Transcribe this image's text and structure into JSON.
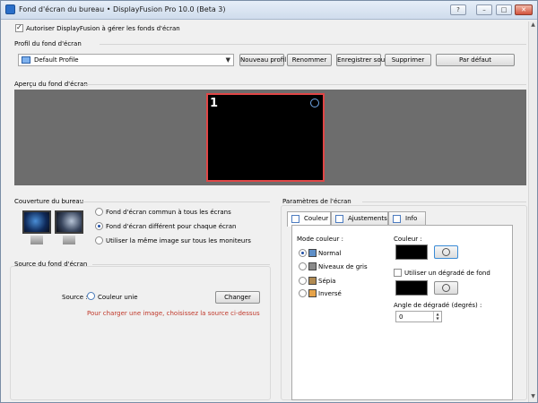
{
  "window": {
    "title": "Fond d'écran du bureau • DisplayFusion Pro 10.0 (Beta 3)",
    "controls": [
      "?",
      "–",
      "□",
      "✕"
    ]
  },
  "manage": {
    "checked": true,
    "label": "Autoriser DisplayFusion à gérer les fonds d'écran"
  },
  "profile": {
    "group_label": "Profil du fond d'écran",
    "selected": "Default Profile",
    "buttons": [
      "Nouveau profil",
      "Renommer",
      "Enregistrer sous",
      "Supprimer",
      "Par défaut"
    ]
  },
  "preview": {
    "group_label": "Aperçu du fond d'écran",
    "monitor_number": "1"
  },
  "coverage": {
    "group_label": "Couverture du bureau",
    "options": [
      {
        "label": "Fond d'écran commun à tous les écrans",
        "selected": false
      },
      {
        "label": "Fond d'écran différent pour chaque écran",
        "selected": true
      },
      {
        "label": "Utiliser la même image sur tous les moniteurs",
        "selected": false
      }
    ]
  },
  "source": {
    "group_label": "Source du fond d'écran",
    "label": "Source :",
    "value": "Couleur unie",
    "change_button": "Changer",
    "hint": "Pour charger une image, choisissez la source ci-dessus",
    "hint_color": "#c0392b"
  },
  "settings": {
    "group_label": "Paramètres de l'écran",
    "tabs": [
      {
        "label": "Couleur",
        "active": true
      },
      {
        "label": "Ajustements",
        "active": false
      },
      {
        "label": "Info",
        "active": false
      }
    ],
    "color_mode": {
      "label": "Mode couleur :",
      "options": [
        {
          "label": "Normal",
          "selected": true
        },
        {
          "label": "Niveaux de gris",
          "selected": false
        },
        {
          "label": "Sépia",
          "selected": false
        },
        {
          "label": "Inversé",
          "selected": false
        }
      ]
    },
    "color": {
      "label": "Couleur :",
      "value": "#000000"
    },
    "gradient": {
      "checked": false,
      "label": "Utiliser un dégradé de fond",
      "value": "#000000"
    },
    "gradient_angle": {
      "label": "Angle de dégradé (degrés) :",
      "value": "0"
    }
  }
}
